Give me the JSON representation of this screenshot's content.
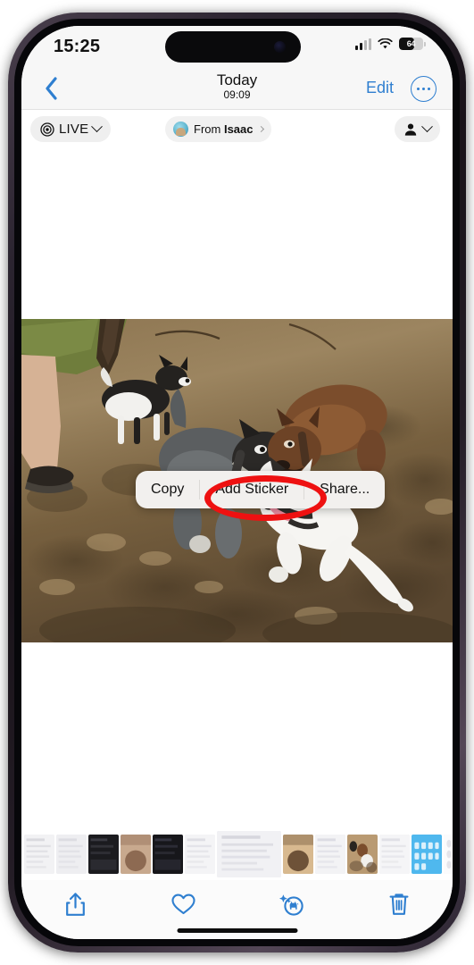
{
  "status_bar": {
    "time": "15:25",
    "battery_percent": "64",
    "battery_level": 64,
    "signal_icon": "cellular-signal-icon",
    "wifi_icon": "wifi-icon",
    "battery_icon": "battery-icon"
  },
  "nav_bar": {
    "back_icon": "chevron-left-icon",
    "title": "Today",
    "subtitle": "09:09",
    "edit_label": "Edit",
    "more_icon": "ellipsis-circle-icon"
  },
  "chips": {
    "live": {
      "label": "LIVE",
      "icon": "live-photo-icon",
      "chevron": "chevron-down-icon"
    },
    "from": {
      "prefix": "From ",
      "name": "Isaac",
      "avatar": "contact-avatar",
      "chevron": "chevron-right-icon"
    },
    "person": {
      "icon": "person-icon",
      "chevron": "chevron-down-icon"
    }
  },
  "context_menu": {
    "items": [
      {
        "label": "Copy",
        "name": "copy"
      },
      {
        "label": "Add Sticker",
        "name": "add-sticker",
        "highlighted": true
      },
      {
        "label": "Share...",
        "name": "share"
      }
    ],
    "highlight_color": "#ee1111"
  },
  "photo": {
    "description": "Four dogs playing at a dirt dog park with dappled tree shadows; a person's leg in sandals at left",
    "alt": "dogs-playing-photo"
  },
  "toolbar": {
    "items": [
      {
        "name": "share-button",
        "icon": "share-icon"
      },
      {
        "name": "favorite-button",
        "icon": "heart-icon"
      },
      {
        "name": "visual-lookup-button",
        "icon": "visual-lookup-dog-icon"
      },
      {
        "name": "delete-button",
        "icon": "trash-icon"
      }
    ],
    "accent_color": "#2f7fd0"
  },
  "filmstrip": {
    "active_index": 6,
    "thumbs": [
      {
        "kind": "doc",
        "c1": "#f2f2f4",
        "c2": "#d9d9de"
      },
      {
        "kind": "doc",
        "c1": "#eeeef1",
        "c2": "#dcdce2"
      },
      {
        "kind": "dark",
        "c1": "#1b1b1f",
        "c2": "#3a3a42"
      },
      {
        "kind": "photo",
        "c1": "#c8a98e",
        "c2": "#8d6a52"
      },
      {
        "kind": "dark",
        "c1": "#17171b",
        "c2": "#343440"
      },
      {
        "kind": "doc",
        "c1": "#f4f4f6",
        "c2": "#dedee4"
      },
      {
        "kind": "doc",
        "c1": "#f1f1f4",
        "c2": "#d6d6dd"
      },
      {
        "kind": "photo",
        "c1": "#d8b98f",
        "c2": "#6e5238"
      },
      {
        "kind": "doc",
        "c1": "#f3f3f5",
        "c2": "#dcdce3"
      },
      {
        "kind": "dogs",
        "c1": "#b99a72",
        "c2": "#5b4631"
      },
      {
        "kind": "doc",
        "c1": "#f5f5f7",
        "c2": "#e0e0e6"
      },
      {
        "kind": "blue",
        "c1": "#4fb8ee",
        "c2": "#2a86c4"
      },
      {
        "kind": "list",
        "c1": "#fbfbfc",
        "c2": "#e4e4ea"
      },
      {
        "kind": "doc",
        "c1": "#f2f2f5",
        "c2": "#dddde3"
      },
      {
        "kind": "yellow",
        "c1": "#f6e08a",
        "c2": "#d8bb4a"
      },
      {
        "kind": "list",
        "c1": "#fafafb",
        "c2": "#e3e3e9"
      },
      {
        "kind": "list",
        "c1": "#f8f8fa",
        "c2": "#e2e2e8"
      },
      {
        "kind": "list",
        "c1": "#fafafc",
        "c2": "#e5e5eb"
      }
    ]
  }
}
